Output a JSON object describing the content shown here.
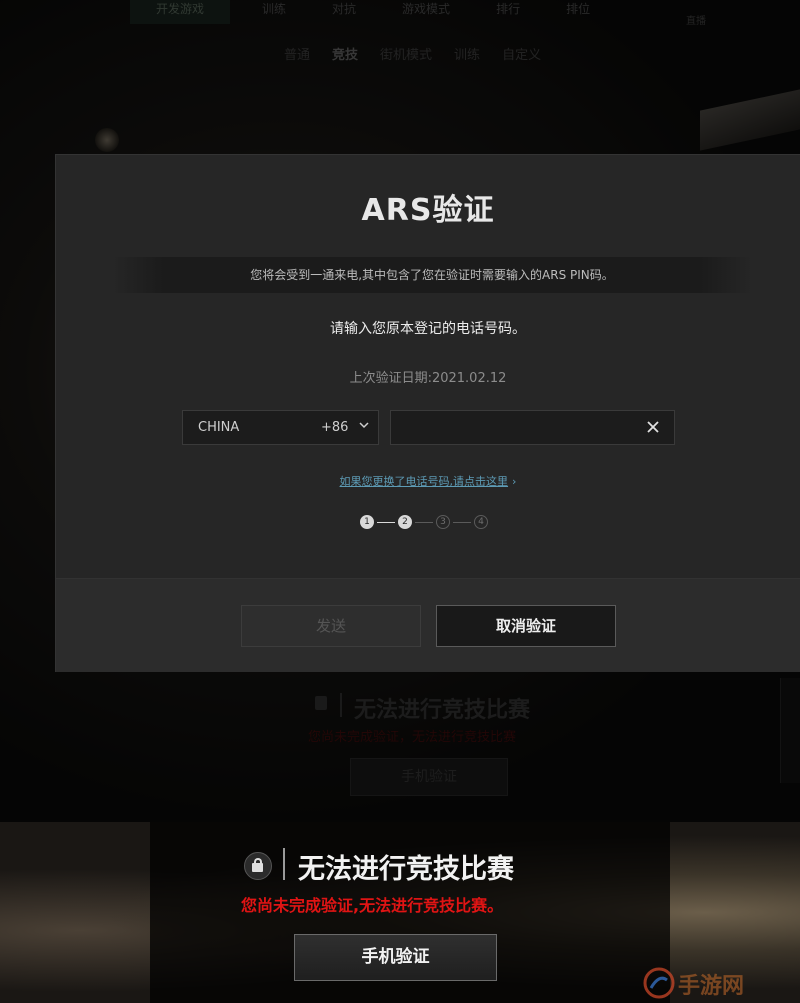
{
  "background": {
    "top_tabs": [
      "开发游戏",
      "训练",
      "对抗",
      "游戏模式",
      "排行",
      "排位"
    ],
    "corner_label": "直播",
    "mode_tabs": [
      "普通",
      "竞技",
      "街机模式",
      "训练",
      "自定义"
    ],
    "dim_title": "无法进行竞技比赛",
    "dim_subtitle": "您尚未完成验证，无法进行竞技比赛",
    "dim_button": "手机验证"
  },
  "dialog": {
    "title": "ARS验证",
    "notice": "您将会受到一通来电,其中包含了您在验证时需要输入的ARS PIN码。",
    "instruction": "请输入您原本登记的电话号码。",
    "last_verified": "上次验证日期:2021.02.12",
    "country": {
      "name": "CHINA",
      "code": "+86"
    },
    "phone": {
      "value": "",
      "placeholder": ""
    },
    "change_link": "如果您更换了电话号码,请点击这里",
    "steps": {
      "labels": [
        "1",
        "2",
        "3",
        "4"
      ],
      "current": 2
    },
    "send_button": "发送",
    "cancel_button": "取消验证"
  },
  "bottom": {
    "title": "无法进行竞技比赛",
    "subtitle": "您尚未完成验证,无法进行竞技比赛。",
    "button": "手机验证",
    "watermark": "手游网"
  },
  "colors": {
    "dialog_bg": "#262626",
    "warning_red": "#e01414",
    "link_blue": "#5d9bb5"
  }
}
